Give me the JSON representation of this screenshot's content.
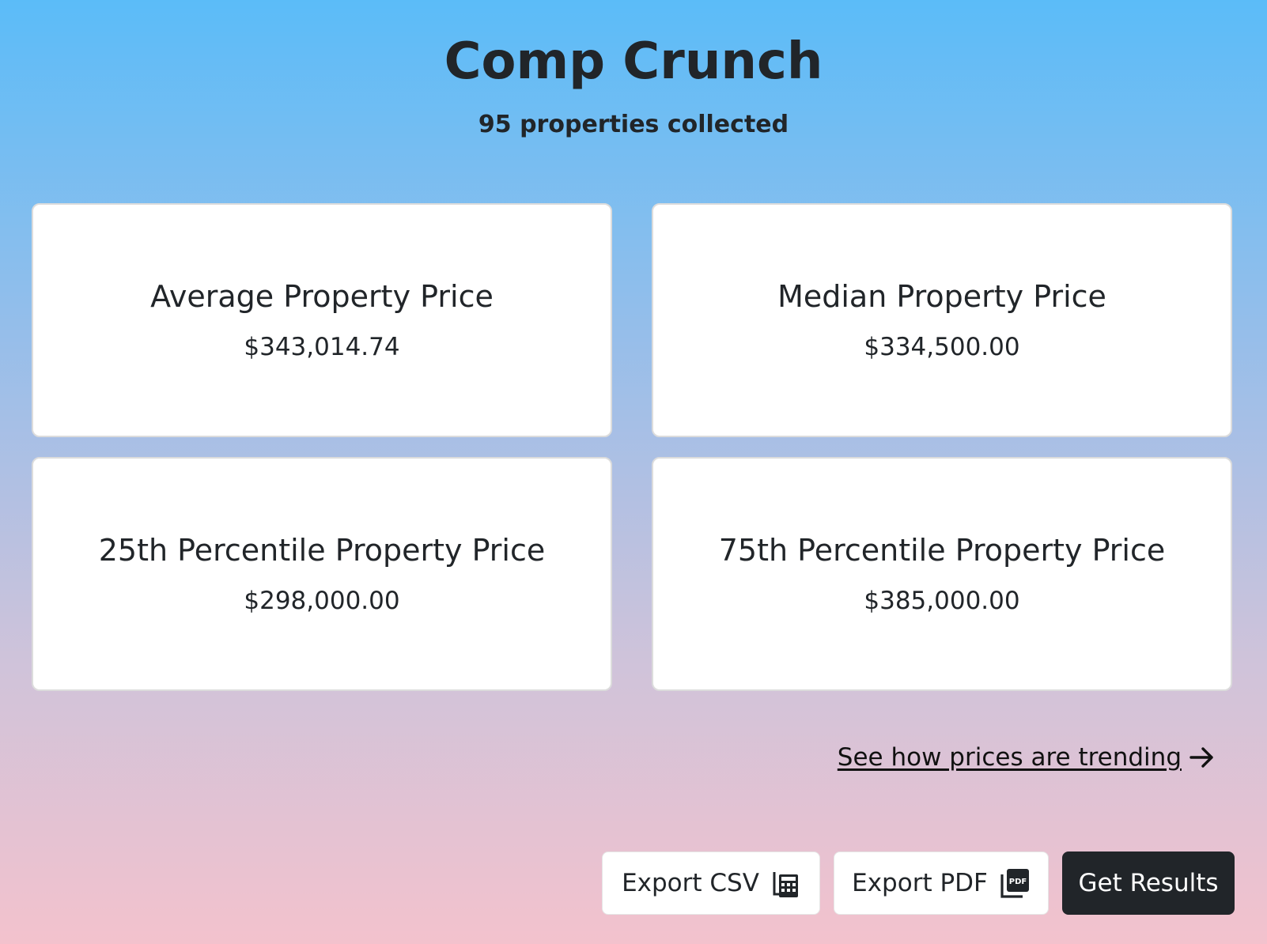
{
  "header": {
    "title": "Comp Crunch",
    "subtitle": "95 properties collected"
  },
  "stats": [
    {
      "label": "Average Property Price",
      "value": "$343,014.74"
    },
    {
      "label": "Median Property Price",
      "value": "$334,500.00"
    },
    {
      "label": "25th Percentile Property Price",
      "value": "$298,000.00"
    },
    {
      "label": "75th Percentile Property Price",
      "value": "$385,000.00"
    }
  ],
  "trend_link": {
    "label": "See how prices are trending",
    "icon": "arrow-right-icon"
  },
  "actions": {
    "export_csv": {
      "label": "Export CSV",
      "icon": "spreadsheet-icon"
    },
    "export_pdf": {
      "label": "Export PDF",
      "icon": "pdf-file-icon"
    },
    "get_results": {
      "label": "Get Results"
    }
  },
  "colors": {
    "gradient_top": "#5bbcf8",
    "gradient_bottom": "#f3c2cd",
    "text": "#212529",
    "dark_button": "#212529"
  }
}
